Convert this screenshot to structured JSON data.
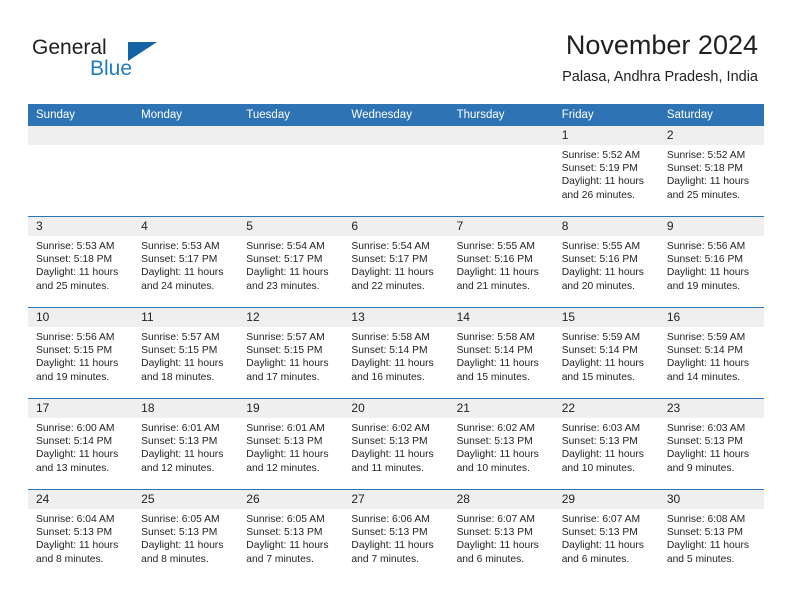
{
  "brand": {
    "name_top": "General",
    "name_bottom": "Blue",
    "accent_color": "#1464a5",
    "blue_text_color": "#1f7cc4",
    "logo_icon": "triangle-icon"
  },
  "header": {
    "title": "November 2024",
    "subtitle": "Palasa, Andhra Pradesh, India"
  },
  "calendar": {
    "header_bg": "#2e74b5",
    "daynum_bg": "#efefef",
    "weekday_headers": [
      "Sunday",
      "Monday",
      "Tuesday",
      "Wednesday",
      "Thursday",
      "Friday",
      "Saturday"
    ],
    "weeks": [
      [
        {
          "day": "",
          "sunrise": "",
          "sunset": "",
          "daylight": ""
        },
        {
          "day": "",
          "sunrise": "",
          "sunset": "",
          "daylight": ""
        },
        {
          "day": "",
          "sunrise": "",
          "sunset": "",
          "daylight": ""
        },
        {
          "day": "",
          "sunrise": "",
          "sunset": "",
          "daylight": ""
        },
        {
          "day": "",
          "sunrise": "",
          "sunset": "",
          "daylight": ""
        },
        {
          "day": "1",
          "sunrise": "Sunrise: 5:52 AM",
          "sunset": "Sunset: 5:19 PM",
          "daylight": "Daylight: 11 hours and 26 minutes."
        },
        {
          "day": "2",
          "sunrise": "Sunrise: 5:52 AM",
          "sunset": "Sunset: 5:18 PM",
          "daylight": "Daylight: 11 hours and 25 minutes."
        }
      ],
      [
        {
          "day": "3",
          "sunrise": "Sunrise: 5:53 AM",
          "sunset": "Sunset: 5:18 PM",
          "daylight": "Daylight: 11 hours and 25 minutes."
        },
        {
          "day": "4",
          "sunrise": "Sunrise: 5:53 AM",
          "sunset": "Sunset: 5:17 PM",
          "daylight": "Daylight: 11 hours and 24 minutes."
        },
        {
          "day": "5",
          "sunrise": "Sunrise: 5:54 AM",
          "sunset": "Sunset: 5:17 PM",
          "daylight": "Daylight: 11 hours and 23 minutes."
        },
        {
          "day": "6",
          "sunrise": "Sunrise: 5:54 AM",
          "sunset": "Sunset: 5:17 PM",
          "daylight": "Daylight: 11 hours and 22 minutes."
        },
        {
          "day": "7",
          "sunrise": "Sunrise: 5:55 AM",
          "sunset": "Sunset: 5:16 PM",
          "daylight": "Daylight: 11 hours and 21 minutes."
        },
        {
          "day": "8",
          "sunrise": "Sunrise: 5:55 AM",
          "sunset": "Sunset: 5:16 PM",
          "daylight": "Daylight: 11 hours and 20 minutes."
        },
        {
          "day": "9",
          "sunrise": "Sunrise: 5:56 AM",
          "sunset": "Sunset: 5:16 PM",
          "daylight": "Daylight: 11 hours and 19 minutes."
        }
      ],
      [
        {
          "day": "10",
          "sunrise": "Sunrise: 5:56 AM",
          "sunset": "Sunset: 5:15 PM",
          "daylight": "Daylight: 11 hours and 19 minutes."
        },
        {
          "day": "11",
          "sunrise": "Sunrise: 5:57 AM",
          "sunset": "Sunset: 5:15 PM",
          "daylight": "Daylight: 11 hours and 18 minutes."
        },
        {
          "day": "12",
          "sunrise": "Sunrise: 5:57 AM",
          "sunset": "Sunset: 5:15 PM",
          "daylight": "Daylight: 11 hours and 17 minutes."
        },
        {
          "day": "13",
          "sunrise": "Sunrise: 5:58 AM",
          "sunset": "Sunset: 5:14 PM",
          "daylight": "Daylight: 11 hours and 16 minutes."
        },
        {
          "day": "14",
          "sunrise": "Sunrise: 5:58 AM",
          "sunset": "Sunset: 5:14 PM",
          "daylight": "Daylight: 11 hours and 15 minutes."
        },
        {
          "day": "15",
          "sunrise": "Sunrise: 5:59 AM",
          "sunset": "Sunset: 5:14 PM",
          "daylight": "Daylight: 11 hours and 15 minutes."
        },
        {
          "day": "16",
          "sunrise": "Sunrise: 5:59 AM",
          "sunset": "Sunset: 5:14 PM",
          "daylight": "Daylight: 11 hours and 14 minutes."
        }
      ],
      [
        {
          "day": "17",
          "sunrise": "Sunrise: 6:00 AM",
          "sunset": "Sunset: 5:14 PM",
          "daylight": "Daylight: 11 hours and 13 minutes."
        },
        {
          "day": "18",
          "sunrise": "Sunrise: 6:01 AM",
          "sunset": "Sunset: 5:13 PM",
          "daylight": "Daylight: 11 hours and 12 minutes."
        },
        {
          "day": "19",
          "sunrise": "Sunrise: 6:01 AM",
          "sunset": "Sunset: 5:13 PM",
          "daylight": "Daylight: 11 hours and 12 minutes."
        },
        {
          "day": "20",
          "sunrise": "Sunrise: 6:02 AM",
          "sunset": "Sunset: 5:13 PM",
          "daylight": "Daylight: 11 hours and 11 minutes."
        },
        {
          "day": "21",
          "sunrise": "Sunrise: 6:02 AM",
          "sunset": "Sunset: 5:13 PM",
          "daylight": "Daylight: 11 hours and 10 minutes."
        },
        {
          "day": "22",
          "sunrise": "Sunrise: 6:03 AM",
          "sunset": "Sunset: 5:13 PM",
          "daylight": "Daylight: 11 hours and 10 minutes."
        },
        {
          "day": "23",
          "sunrise": "Sunrise: 6:03 AM",
          "sunset": "Sunset: 5:13 PM",
          "daylight": "Daylight: 11 hours and 9 minutes."
        }
      ],
      [
        {
          "day": "24",
          "sunrise": "Sunrise: 6:04 AM",
          "sunset": "Sunset: 5:13 PM",
          "daylight": "Daylight: 11 hours and 8 minutes."
        },
        {
          "day": "25",
          "sunrise": "Sunrise: 6:05 AM",
          "sunset": "Sunset: 5:13 PM",
          "daylight": "Daylight: 11 hours and 8 minutes."
        },
        {
          "day": "26",
          "sunrise": "Sunrise: 6:05 AM",
          "sunset": "Sunset: 5:13 PM",
          "daylight": "Daylight: 11 hours and 7 minutes."
        },
        {
          "day": "27",
          "sunrise": "Sunrise: 6:06 AM",
          "sunset": "Sunset: 5:13 PM",
          "daylight": "Daylight: 11 hours and 7 minutes."
        },
        {
          "day": "28",
          "sunrise": "Sunrise: 6:07 AM",
          "sunset": "Sunset: 5:13 PM",
          "daylight": "Daylight: 11 hours and 6 minutes."
        },
        {
          "day": "29",
          "sunrise": "Sunrise: 6:07 AM",
          "sunset": "Sunset: 5:13 PM",
          "daylight": "Daylight: 11 hours and 6 minutes."
        },
        {
          "day": "30",
          "sunrise": "Sunrise: 6:08 AM",
          "sunset": "Sunset: 5:13 PM",
          "daylight": "Daylight: 11 hours and 5 minutes."
        }
      ]
    ]
  }
}
